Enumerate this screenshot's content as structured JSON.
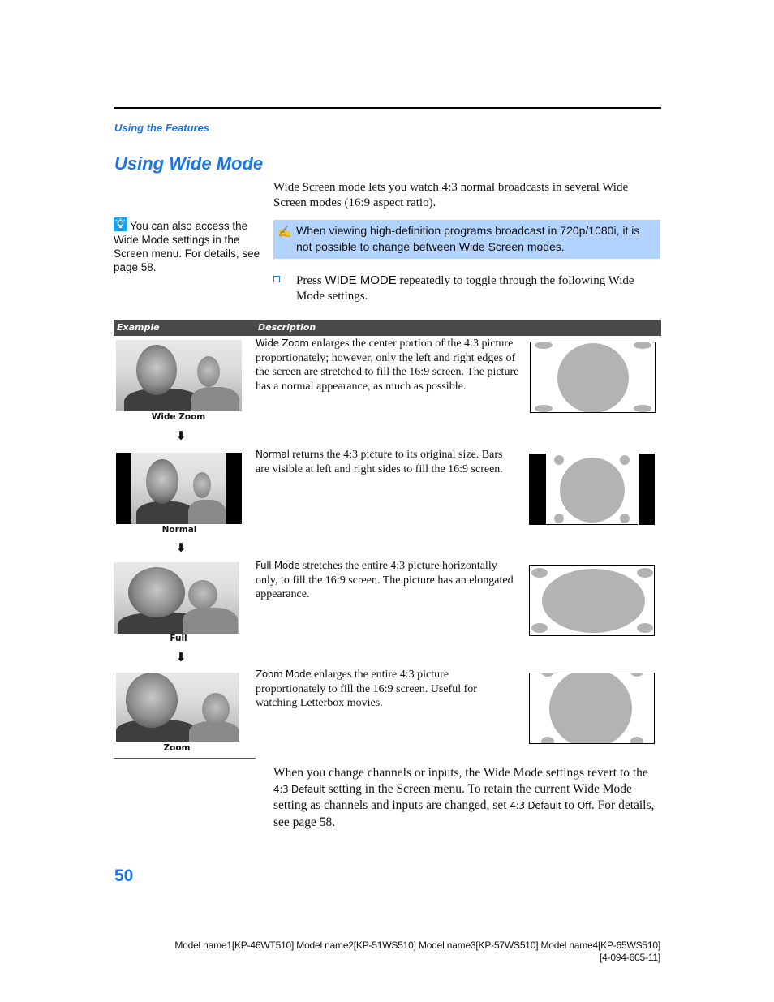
{
  "header": {
    "section_label": "Using the Features",
    "page_title": "Using Wide Mode"
  },
  "intro": {
    "text": "Wide Screen mode lets you watch 4:3 normal broadcasts in several Wide Screen modes (16:9 aspect ratio)."
  },
  "tip": {
    "icon": "lightbulb-tip-icon",
    "text": "You can also access the Wide Mode settings in the Screen menu. For details, see page 58."
  },
  "note": {
    "icon": "pencil-note-icon",
    "text": "When viewing high-definition programs broadcast in 720p/1080i, it is not possible to change between Wide Screen modes."
  },
  "step": {
    "prefix": "Press ",
    "button_name": "WIDE MODE",
    "suffix": " repeatedly to toggle through the following Wide Mode settings."
  },
  "table": {
    "headers": [
      "Example",
      "Description"
    ],
    "rows": [
      {
        "caption": "Wide Zoom",
        "mode_name": "Wide Zoom",
        "description": " enlarges the center portion of the 4:3 picture proportionately; however, only the left and right edges of the screen are stretched to fill the 16:9 screen. The picture has a normal appearance, as much as possible."
      },
      {
        "caption": "Normal",
        "mode_name": "Normal",
        "description": " returns the 4:3 picture to its original size. Bars are visible at left and right sides to fill the 16:9 screen."
      },
      {
        "caption": "Full",
        "mode_name": "Full Mode",
        "description": " stretches the entire 4:3 picture horizontally only, to fill the 16:9 screen. The picture has an elongated appearance."
      },
      {
        "caption": "Zoom",
        "mode_name": "Zoom Mode",
        "description": " enlarges the entire 4:3 picture proportionately to fill the 16:9 screen. Useful for watching Letterbox movies."
      }
    ],
    "arrow_glyph": "⬇"
  },
  "closing": {
    "part1": "When you change channels or inputs, the Wide Mode settings revert to the ",
    "setting1": "4:3 Default",
    "part2": " setting in the Screen menu. To retain the current Wide Mode setting as channels and inputs are changed, set ",
    "setting2": "4:3 Default",
    "part3": " to ",
    "value": "Off",
    "part4": ". For details, see page 58."
  },
  "footer": {
    "page_number": "50",
    "models": "Model name1[KP-46WT510] Model name2[KP-51WS510] Model name3[KP-57WS510] Model name4[KP-65WS510]",
    "doc_code": "[4-094-605-11]"
  },
  "colors": {
    "accent_blue": "#1a75e8",
    "note_background": "#b3d3ff",
    "table_header": "#4a4a4a",
    "diagram_gray": "#b3b3b3"
  }
}
